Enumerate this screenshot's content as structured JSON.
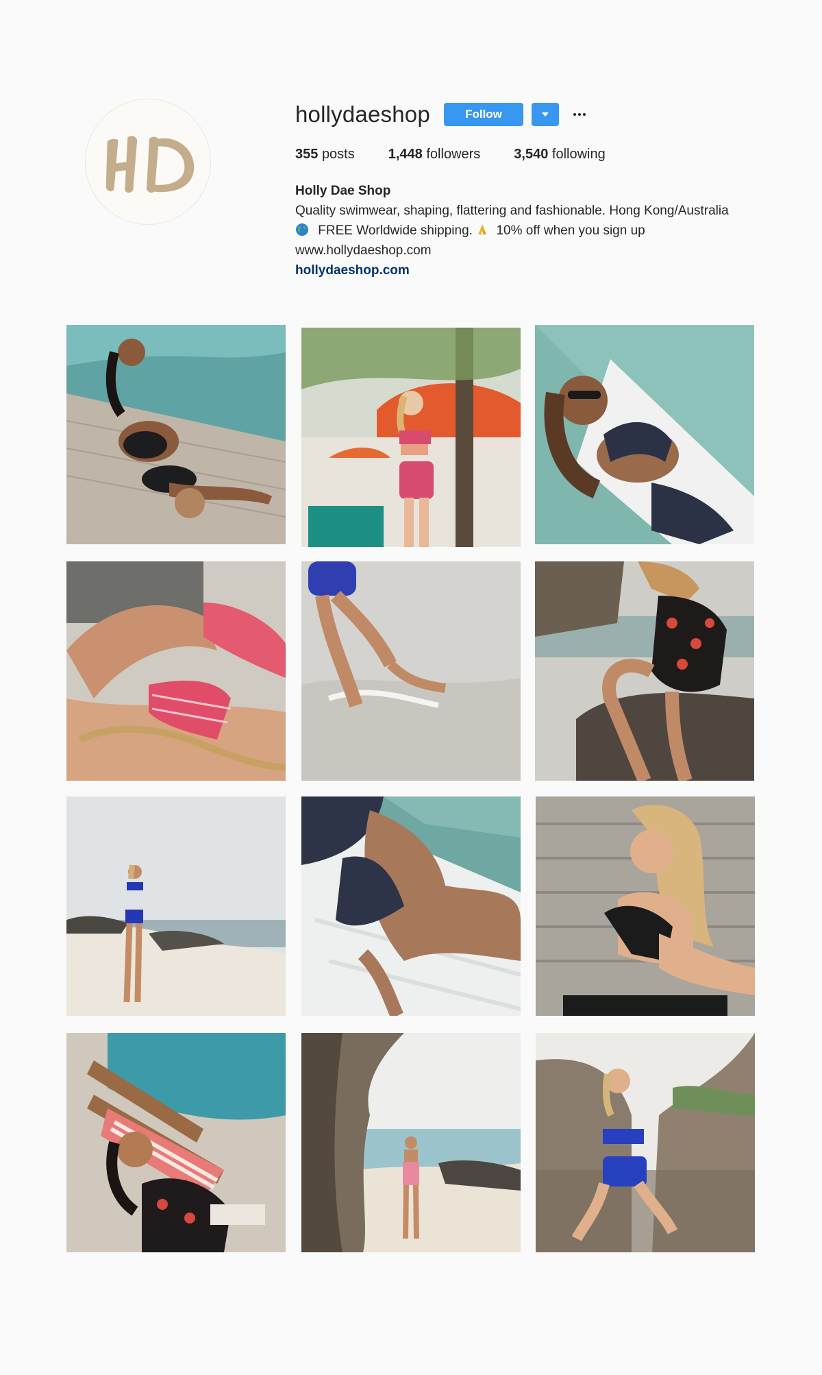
{
  "profile": {
    "username": "hollydaeshop",
    "avatar_label": "HD",
    "follow_label": "Follow",
    "dropdown_icon": "caret-down-icon",
    "more_icon": "ellipsis-icon",
    "stats": {
      "posts_count": "355",
      "posts_label": "posts",
      "followers_count": "1,448",
      "followers_label": "followers",
      "following_count": "3,540",
      "following_label": "following"
    },
    "bio": {
      "full_name": "Holly Dae Shop",
      "line1": "Quality swimwear, shaping, flattering and fashionable. Hong Kong/Australia",
      "line2_a": "FREE Worldwide shipping.",
      "line2_b": "10% off when you sign up",
      "line3": "www.hollydaeshop.com",
      "link": "hollydaeshop.com"
    },
    "colors": {
      "follow_blue": "#3897f0",
      "link_blue": "#003569",
      "background": "#fafafa"
    }
  },
  "posts": [
    {
      "scene": "woman in black ruffle bikini sunbathing on pool deck with coconut"
    },
    {
      "scene": "woman in pink striped swimsuit under orange umbrellas and palm trees"
    },
    {
      "scene": "woman in navy ruffle bikini with sunglasses on white lounger"
    },
    {
      "scene": "pink striped bikini on rattan chair close-up"
    },
    {
      "scene": "legs in blue high-waist bikini kicking water at shoreline"
    },
    {
      "scene": "woman in black floral one-piece sitting on rocks"
    },
    {
      "scene": "woman in blue bikini standing on beach"
    },
    {
      "scene": "navy ruffle bikini close-up on white lounger"
    },
    {
      "scene": "blonde woman in black ruffle top by stone wall"
    },
    {
      "scene": "woman in floral swimsuit on striped deck chair by pool"
    },
    {
      "scene": "woman in pink swimsuit walking on beach through rock arch"
    },
    {
      "scene": "woman in blue bikini sitting on rocks"
    }
  ]
}
